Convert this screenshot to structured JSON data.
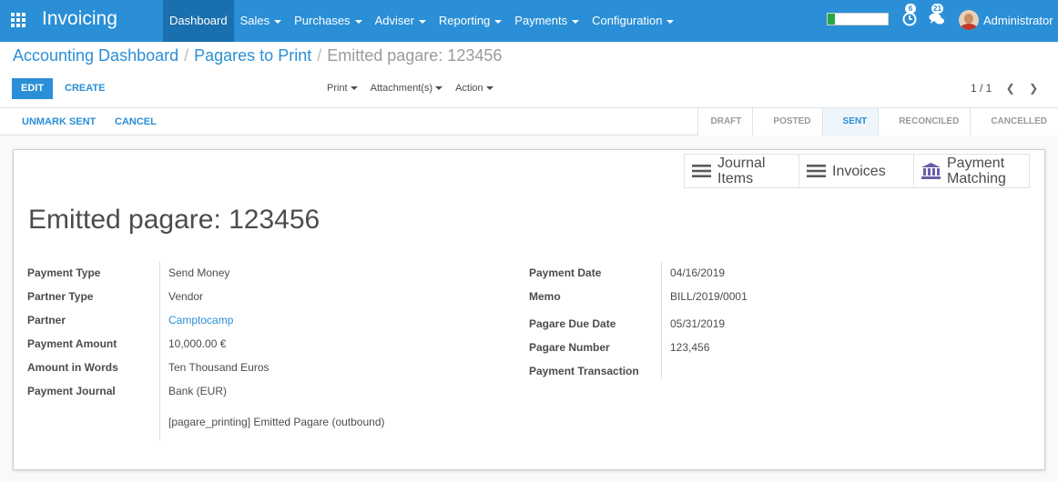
{
  "navbar": {
    "app_name": "Invoicing",
    "menu": [
      {
        "label": "Dashboard",
        "active": true,
        "dropdown": false
      },
      {
        "label": "Sales",
        "dropdown": true
      },
      {
        "label": "Purchases",
        "dropdown": true
      },
      {
        "label": "Adviser",
        "dropdown": true
      },
      {
        "label": "Reporting",
        "dropdown": true
      },
      {
        "label": "Payments",
        "dropdown": true
      },
      {
        "label": "Configuration",
        "dropdown": true
      }
    ],
    "progress_fraction": 0.12,
    "activity_count": "6",
    "messages_count": "21",
    "user_name": "Administrator",
    "accent_color": "#2a8fd6"
  },
  "breadcrumb": {
    "items": [
      "Accounting Dashboard",
      "Pagares to Print"
    ],
    "current": "Emitted pagare: 123456"
  },
  "toolbar": {
    "edit_label": "EDIT",
    "create_label": "CREATE",
    "print_label": "Print",
    "attachments_label": "Attachment(s)",
    "action_label": "Action",
    "pager_value": "1 / 1"
  },
  "statusbar": {
    "unmark_sent_label": "UNMARK SENT",
    "cancel_label": "CANCEL",
    "stages": [
      "DRAFT",
      "POSTED",
      "SENT",
      "RECONCILED",
      "CANCELLED"
    ],
    "active_stage": "SENT"
  },
  "smart_buttons": [
    {
      "label_line1": "Journal",
      "label_line2": "Items",
      "icon": "list-icon"
    },
    {
      "label_line1": "Invoices",
      "label_line2": "",
      "icon": "list-icon"
    },
    {
      "label_line1": "Payment",
      "label_line2": "Matching",
      "icon": "bank-icon"
    }
  ],
  "record": {
    "title": "Emitted pagare: 123456",
    "left_fields": [
      {
        "label": "Payment Type",
        "value": "Send Money"
      },
      {
        "label": "Partner Type",
        "value": "Vendor"
      },
      {
        "label": "Partner",
        "value": "Camptocamp"
      },
      {
        "label": "Payment Amount",
        "value": "10,000.00 €"
      },
      {
        "label": "Amount in Words",
        "value": "Ten Thousand Euros"
      },
      {
        "label": "Payment Journal",
        "value": "Bank (EUR)"
      }
    ],
    "journal_extra": "[pagare_printing] Emitted Pagare (outbound)",
    "right_fields": [
      {
        "label": "Payment Date",
        "value": "04/16/2019"
      },
      {
        "label": "Memo",
        "value": "BILL/2019/0001"
      },
      {
        "label": "Pagare Due Date",
        "value": "05/31/2019"
      },
      {
        "label": "Pagare Number",
        "value": "123,456"
      },
      {
        "label": "Payment Transaction",
        "value": ""
      }
    ]
  }
}
